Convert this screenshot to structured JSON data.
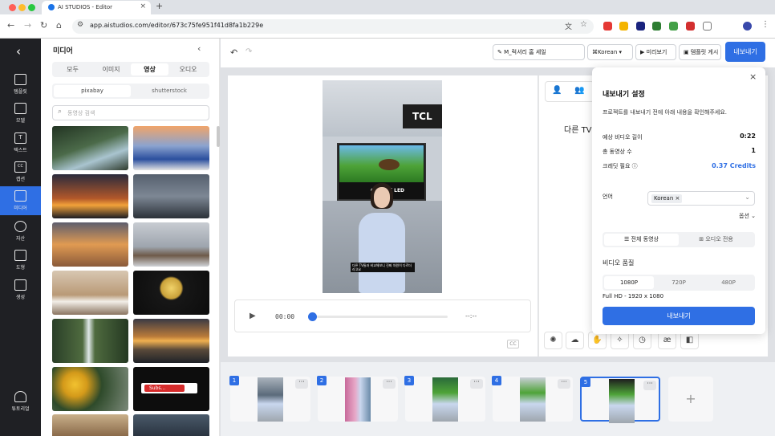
{
  "browser": {
    "tab_title": "AI STUDIOS - Editor",
    "tab_close": "×",
    "new_tab": "+",
    "url": "app.aistudios.com/editor/673c75fe951f41d8fa1b229e"
  },
  "rail": {
    "back": "‹",
    "items": [
      {
        "label": "템플릿",
        "glyph": ""
      },
      {
        "label": "모델",
        "glyph": ""
      },
      {
        "label": "텍스트",
        "glyph": "T"
      },
      {
        "label": "캡션",
        "glyph": "CC"
      },
      {
        "label": "미디어",
        "glyph": ""
      },
      {
        "label": "자산",
        "glyph": ""
      },
      {
        "label": "도형",
        "glyph": ""
      },
      {
        "label": "생성",
        "glyph": ""
      },
      {
        "label": "튜토리얼",
        "glyph": ""
      }
    ]
  },
  "media": {
    "title": "미디어",
    "type_tabs": [
      "모두",
      "이미지",
      "영상",
      "오디오"
    ],
    "source_tabs": [
      "pixabay",
      "shutterstock"
    ],
    "search_placeholder": "동영상 검색",
    "thumb_badge": "Subs..."
  },
  "topbar": {
    "project_name": "M_럭셔리 홈 세일",
    "language": "Korean",
    "preview": "미리보기",
    "template_post": "템플릿 게시",
    "export": "내보내기"
  },
  "video": {
    "brand": "TCL",
    "tv_label": "QD-Mini LED",
    "subtitle": "다른 TV들과 비교해보니 진짜 차원이 다르더라고요"
  },
  "player": {
    "time": "00:00",
    "end_time": "--:--",
    "cc": "CC"
  },
  "script": {
    "text": "다른 TV들"
  },
  "export_panel": {
    "title": "내보내기 설정",
    "close": "×",
    "desc": "프로젝트를 내보내기 전에 아래 내용을 확인해주세요.",
    "duration_label": "예상 비디오 길이",
    "duration_value": "0:22",
    "scenes_label": "총 동영상 수",
    "scenes_value": "1",
    "credits_label": "크레딧 필요",
    "credits_value": "0.37 Credits",
    "language_label": "언어",
    "language_value": "Korean",
    "options_label": "옵션",
    "modes": [
      "전체 동영상",
      "오디오 전용"
    ],
    "quality_label": "비디오 품질",
    "qualities": [
      "1080P",
      "720P",
      "480P"
    ],
    "quality_desc": "Full HD - 1920 x 1080",
    "export_button": "내보내기"
  },
  "timeline": {
    "scenes": [
      "1",
      "2",
      "3",
      "4",
      "5"
    ],
    "more": "···",
    "add": "+"
  },
  "colors": {
    "accent": "#2f6fe4",
    "rail_bg": "#1f2024"
  }
}
